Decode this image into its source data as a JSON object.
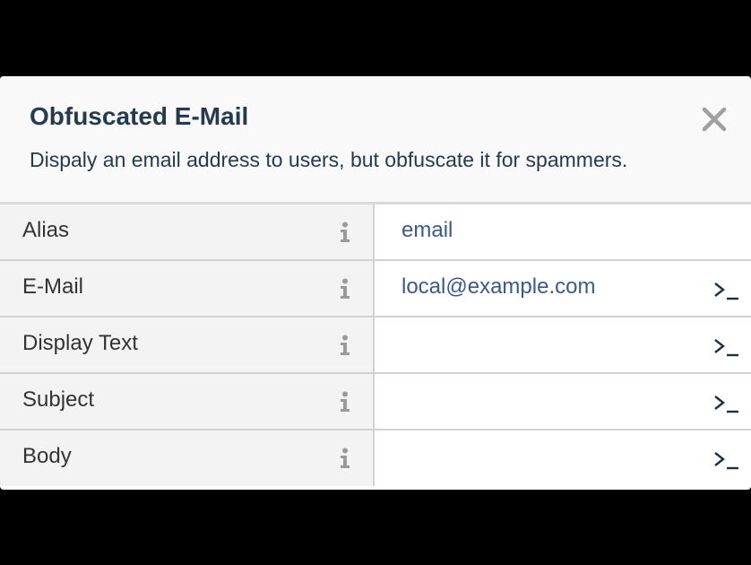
{
  "dialog": {
    "title": "Obfuscated E-Mail",
    "description": "Dispaly an email address to users, but obfuscate it for spammers.",
    "close_icon": "close-icon"
  },
  "properties": [
    {
      "label": "Alias",
      "value": "email",
      "has_expression_button": false
    },
    {
      "label": "E-Mail",
      "value": "local@example.com",
      "has_expression_button": true
    },
    {
      "label": "Display Text",
      "value": "",
      "has_expression_button": true
    },
    {
      "label": "Subject",
      "value": "",
      "has_expression_button": true
    },
    {
      "label": "Body",
      "value": "",
      "has_expression_button": true
    }
  ],
  "colors": {
    "title": "#263a4f",
    "value_text": "#3b5a88",
    "label_bg": "#f3f3f3",
    "icon_gray": "#9a9a9a"
  }
}
